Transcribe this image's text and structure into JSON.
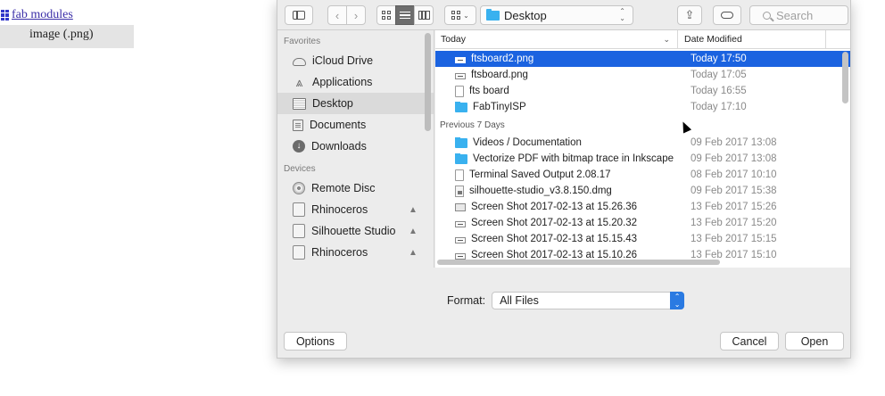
{
  "page": {
    "link_text": "fab modules",
    "menu_item": "image (.png)"
  },
  "toolbar": {
    "location": "Desktop",
    "search_placeholder": "Search"
  },
  "sidebar": {
    "favorites_heading": "Favorites",
    "favorites": [
      {
        "label": "iCloud Drive",
        "icon": "cloud-icon"
      },
      {
        "label": "Applications",
        "icon": "applications-icon"
      },
      {
        "label": "Desktop",
        "icon": "desktop-icon"
      },
      {
        "label": "Documents",
        "icon": "documents-icon"
      },
      {
        "label": "Downloads",
        "icon": "downloads-icon"
      }
    ],
    "devices_heading": "Devices",
    "devices": [
      {
        "label": "Remote Disc",
        "icon": "disc-icon"
      },
      {
        "label": "Rhinoceros",
        "icon": "drive-icon",
        "eject": "▲"
      },
      {
        "label": "Silhouette Studio",
        "icon": "drive-icon",
        "eject": "▲"
      },
      {
        "label": "Rhinoceros",
        "icon": "drive-icon",
        "eject": "▲"
      }
    ]
  },
  "file_list": {
    "columns": {
      "name": "Today",
      "date": "Date Modified"
    },
    "today": [
      {
        "name": "ftsboard2.png",
        "date": "Today 17:50",
        "icon": "png-icon",
        "selected": true
      },
      {
        "name": "ftsboard.png",
        "date": "Today 17:05",
        "icon": "png-icon"
      },
      {
        "name": "fts board",
        "date": "Today 16:55",
        "icon": "document-icon"
      },
      {
        "name": "FabTinyISP",
        "date": "Today 17:10",
        "icon": "folder-icon"
      }
    ],
    "previous_heading": "Previous 7 Days",
    "previous": [
      {
        "name": "Videos / Documentation",
        "date": "09 Feb 2017 13:08",
        "icon": "folder-icon"
      },
      {
        "name": "Vectorize PDF with bitmap trace in Inkscape",
        "date": "09 Feb 2017 13:08",
        "icon": "folder-icon"
      },
      {
        "name": "Terminal Saved Output 2.08.17",
        "date": "08 Feb 2017 10:10",
        "icon": "document-icon"
      },
      {
        "name": "silhouette-studio_v3.8.150.dmg",
        "date": "09 Feb 2017 15:38",
        "icon": "dmg-icon"
      },
      {
        "name": "Screen Shot 2017-02-13 at 15.26.36",
        "date": "13 Feb 2017 15:26",
        "icon": "screenshot-icon"
      },
      {
        "name": "Screen Shot 2017-02-13 at 15.20.32",
        "date": "13 Feb 2017 15:20",
        "icon": "png-icon"
      },
      {
        "name": "Screen Shot 2017-02-13 at 15.15.43",
        "date": "13 Feb 2017 15:15",
        "icon": "png-icon"
      },
      {
        "name": "Screen Shot 2017-02-13 at 15.10.26",
        "date": "13 Feb 2017 15:10",
        "icon": "png-icon"
      }
    ]
  },
  "format": {
    "label": "Format:",
    "value": "All Files"
  },
  "buttons": {
    "options": "Options",
    "cancel": "Cancel",
    "open": "Open"
  }
}
